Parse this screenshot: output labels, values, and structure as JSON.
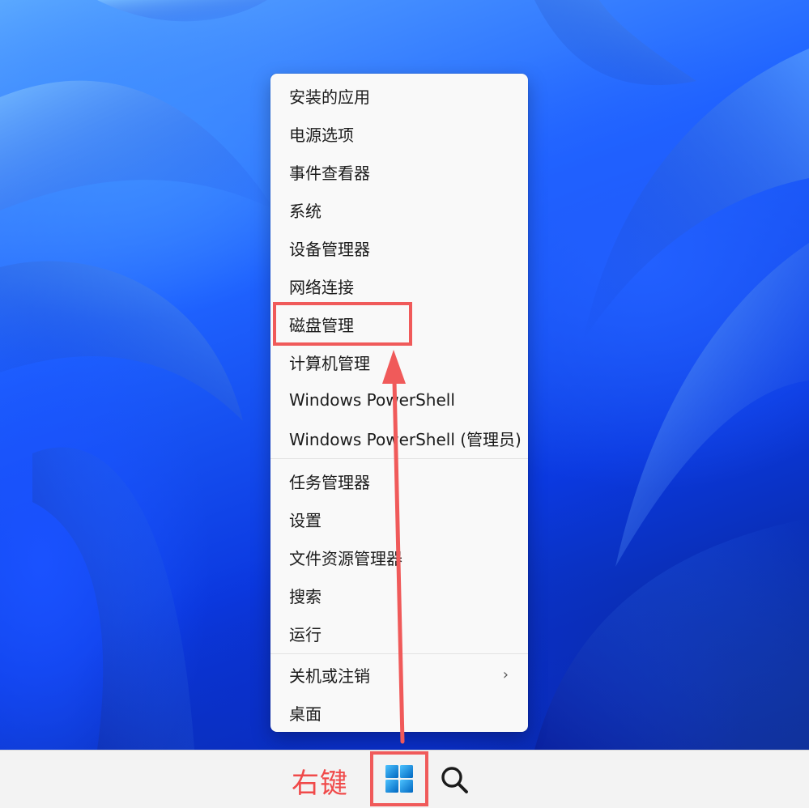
{
  "context_menu": {
    "items": [
      {
        "label": "安装的应用"
      },
      {
        "label": "电源选项"
      },
      {
        "label": "事件查看器"
      },
      {
        "label": "系统"
      },
      {
        "label": "设备管理器"
      },
      {
        "label": "网络连接"
      },
      {
        "label": "磁盘管理"
      },
      {
        "label": "计算机管理"
      },
      {
        "label": "Windows PowerShell"
      },
      {
        "label": "Windows PowerShell (管理员)"
      },
      {
        "label": "任务管理器"
      },
      {
        "label": "设置"
      },
      {
        "label": "文件资源管理器"
      },
      {
        "label": "搜索"
      },
      {
        "label": "运行"
      },
      {
        "label": "关机或注销",
        "submenu_indicator": "›"
      },
      {
        "label": "桌面"
      }
    ],
    "highlighted_item": "磁盘管理"
  },
  "annotation": {
    "label": "右键",
    "color": "#f05a5a"
  },
  "taskbar": {
    "start_icon": "windows-logo-icon",
    "search_icon": "search-icon",
    "accent": "#1f7ae0"
  }
}
